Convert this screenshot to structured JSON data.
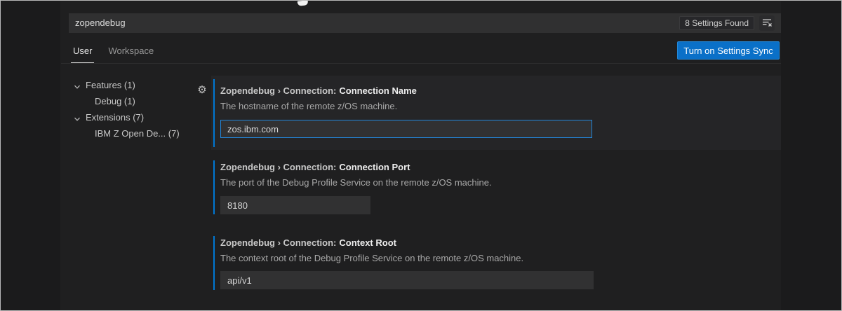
{
  "search": {
    "value": "zopendebug",
    "results_badge": "8 Settings Found"
  },
  "header": {
    "tabs": [
      {
        "label": "User",
        "active": true
      },
      {
        "label": "Workspace",
        "active": false
      }
    ],
    "sync_button_label": "Turn on Settings Sync"
  },
  "toc": {
    "items": [
      {
        "label": "Features (1)",
        "level": 0,
        "expanded": true
      },
      {
        "label": "Debug (1)",
        "level": 1
      },
      {
        "label": "Extensions (7)",
        "level": 0,
        "expanded": true
      },
      {
        "label": "IBM Z Open De... (7)",
        "level": 1
      }
    ]
  },
  "settings": [
    {
      "category": "Zopendebug › Connection:",
      "name": "Connection Name",
      "description": "The hostname of the remote z/OS machine.",
      "value": "zos.ibm.com",
      "focused": true,
      "modified": true
    },
    {
      "category": "Zopendebug › Connection:",
      "name": "Connection Port",
      "description": "The port of the Debug Profile Service on the remote z/OS machine.",
      "value": "8180",
      "focused": false,
      "modified": true
    },
    {
      "category": "Zopendebug › Connection:",
      "name": "Context Root",
      "description": "The context root of the Debug Profile Service on the remote z/OS machine.",
      "value": "api/v1",
      "focused": false,
      "modified": true
    }
  ],
  "icons": {
    "gear_icon": "⚙",
    "clear_filter_icon": "clear-filter-icon",
    "chevron_down_icon": "chevron-down-icon"
  },
  "colors": {
    "accent_blue": "#0a70c8",
    "focus_border": "#2386d9",
    "modified_indicator": "#0078d4",
    "editor_background": "#1f1f20",
    "input_background": "#313132",
    "focused_row_background": "#252527"
  }
}
